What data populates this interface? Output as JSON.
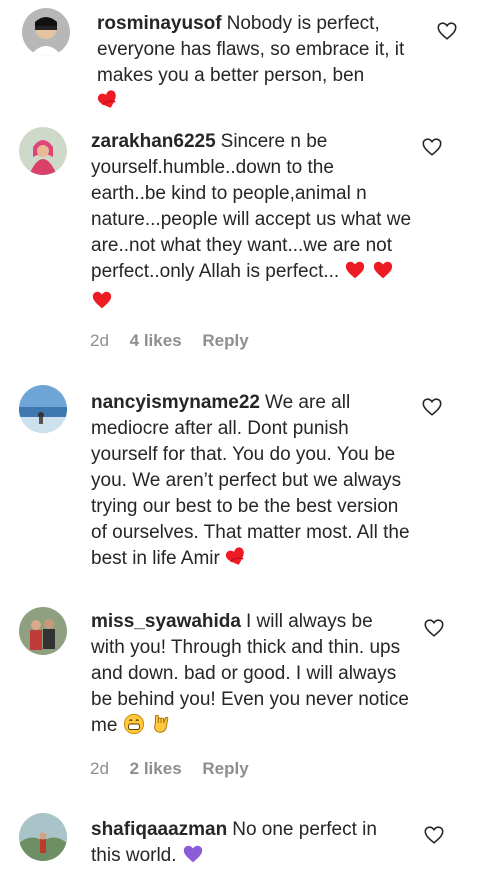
{
  "comments": [
    {
      "username": "rosminayusof",
      "text": "Nobody is perfect, everyone has flaws, so embrace it, it makes you a better person, ben",
      "emojis": [
        "heart-on-fire"
      ]
    },
    {
      "username": "zarakhan6225",
      "text": "Sincere n be yourself.humble..down to the earth..be kind to people,animal n nature...people will accept us what we are..not what they want...we are not perfect..only Allah is perfect...",
      "emojis": [
        "red-heart",
        "red-heart",
        "red-heart"
      ],
      "age": "2d",
      "likes": "4 likes",
      "reply": "Reply"
    },
    {
      "username": "nancyismyname22",
      "text": "We are all mediocre after all. Dont punish yourself for that. You do you. You be you. We aren’t perfect but we always trying our best to be the best version of ourselves. That matter most. All the best in life Amir",
      "emojis": [
        "heart-on-fire"
      ]
    },
    {
      "username": "miss_syawahida",
      "text": "I will always be with you! Through thick and thin. ups and down. bad or good. I will always be behind you! Even you never notice me",
      "emojis": [
        "grinning-face",
        "love-you-gesture"
      ],
      "age": "2d",
      "likes": "2 likes",
      "reply": "Reply"
    },
    {
      "username": "shafiqaaazman",
      "text": "No one perfect in this world.",
      "emojis": [
        "purple-heart"
      ]
    }
  ],
  "colors": {
    "text": "#262626",
    "meta": "#8e8e8e",
    "heart_red": "#ed1c24",
    "heart_purple": "#8a5cd6"
  }
}
